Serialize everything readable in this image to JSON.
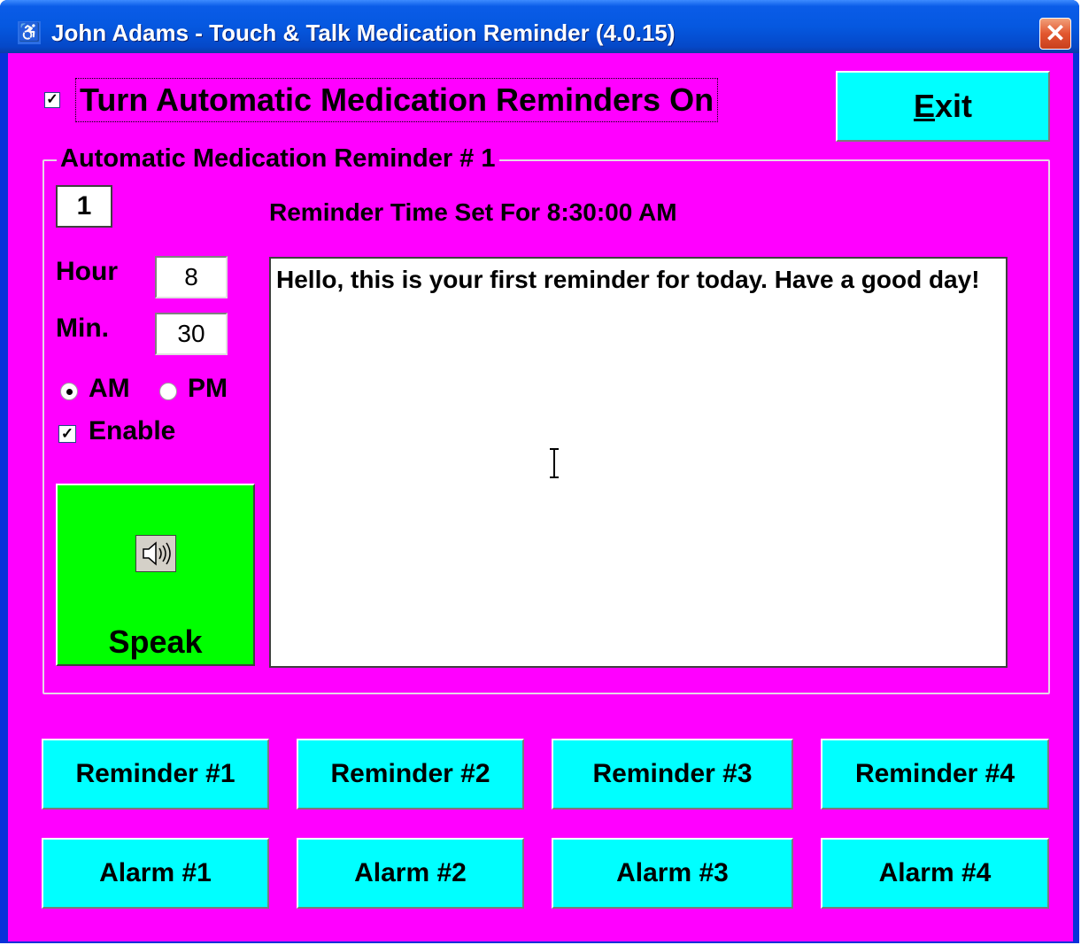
{
  "window": {
    "title": "John Adams - Touch & Talk Medication Reminder (4.0.15)",
    "app_icon_glyph": "♿",
    "close_glyph": "✕"
  },
  "main": {
    "auto_reminders_label": "Turn Automatic Medication Reminders On",
    "auto_reminders_checked": true,
    "exit_label": "Exit",
    "exit_mnemonic": "E",
    "exit_rest": "xit"
  },
  "reminder_group": {
    "title": "Automatic Medication Reminder # 1",
    "number": "1",
    "time_text": "Reminder Time Set For 8:30:00 AM",
    "hour_label": "Hour",
    "hour_value": "8",
    "min_label": "Min.",
    "min_value": "30",
    "am_label": "AM",
    "pm_label": "PM",
    "selected_period": "AM",
    "enable_label": "Enable",
    "enable_checked": true,
    "speak_label": "Speak",
    "message": "Hello, this is your first reminder for today. Have a good day!"
  },
  "reminder_buttons": [
    "Reminder #1",
    "Reminder #2",
    "Reminder #3",
    "Reminder #4"
  ],
  "alarm_buttons": [
    "Alarm #1",
    "Alarm #2",
    "Alarm #3",
    "Alarm #4"
  ],
  "colors": {
    "background": "#ff00ff",
    "button": "#00ffff",
    "speak_button": "#00ff00"
  }
}
